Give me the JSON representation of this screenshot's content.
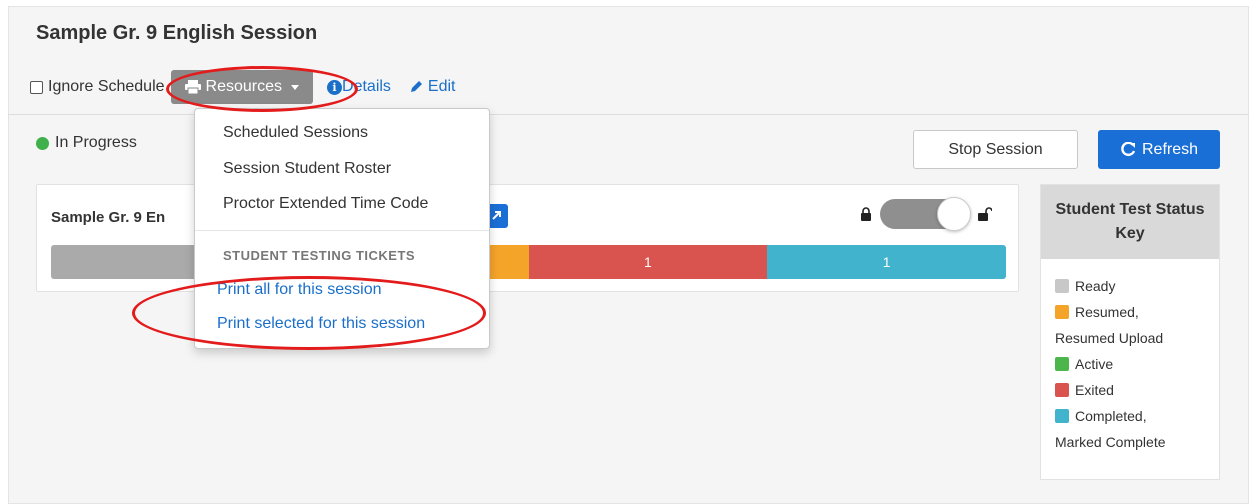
{
  "session": {
    "title": "Sample Gr. 9 English Session",
    "ignore_schedule_label": "Ignore Schedule",
    "resources_label": "Resources",
    "details_label": "Details",
    "edit_label": "Edit",
    "status_text": "In Progress",
    "stop_label": "Stop Session",
    "refresh_label": "Refresh"
  },
  "resources_menu": {
    "items": [
      "Scheduled Sessions",
      "Session Student Roster",
      "Proctor Extended Time Code"
    ],
    "section_header": "STUDENT TESTING TICKETS",
    "links": [
      "Print all for this session",
      "Print selected for this session"
    ]
  },
  "test": {
    "name": "Sample Gr. 9 En",
    "progress": [
      {
        "status": "Ready",
        "count": "",
        "color": "#aaaaaa",
        "fraction": 0.25
      },
      {
        "status": "Resumed",
        "count": "1",
        "color": "#f5a42a",
        "fraction": 0.25
      },
      {
        "status": "Exited",
        "count": "1",
        "color": "#d9534f",
        "fraction": 0.25
      },
      {
        "status": "Completed",
        "count": "1",
        "color": "#41b3cc",
        "fraction": 0.25
      }
    ]
  },
  "legend": {
    "title": "Student Test Status Key",
    "items": [
      {
        "label": "Ready",
        "color": "#c8c8c8"
      },
      {
        "label": "Resumed,",
        "label2": "Resumed Upload",
        "color": "#f5a42a"
      },
      {
        "label": "Active",
        "color": "#4cb64c"
      },
      {
        "label": "Exited",
        "color": "#d9534f"
      },
      {
        "label": "Completed,",
        "label2": "Marked Complete",
        "color": "#41b3cc"
      }
    ]
  },
  "colors": {
    "accent": "#1a6fd6",
    "link": "#1a6fc9",
    "annotation": "#e31b1b"
  }
}
